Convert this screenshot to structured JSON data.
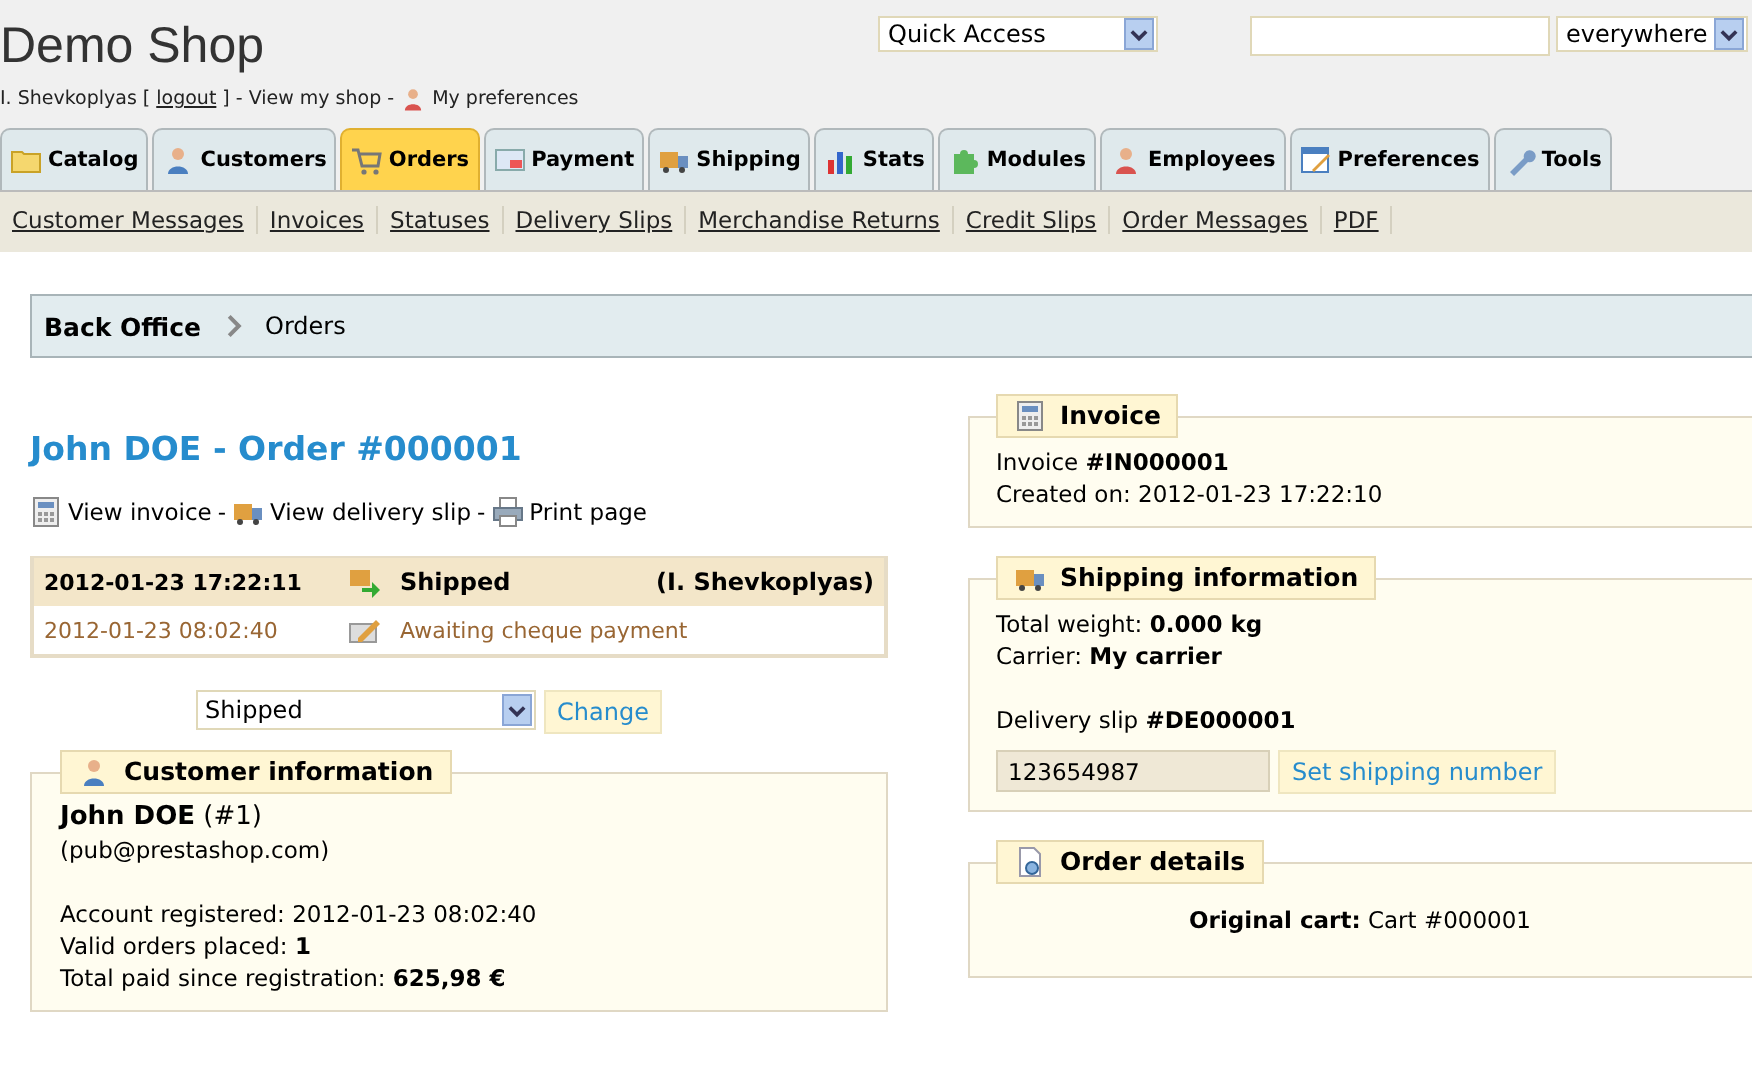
{
  "header": {
    "title": "Demo Shop",
    "quick_access": "Quick Access",
    "search_scope": "everywhere"
  },
  "user_bar": {
    "user": "I. Shevkoplyas [",
    "logout": "logout",
    "middle": "] - View my shop -",
    "preferences": "My preferences"
  },
  "tabs": [
    {
      "label": "Catalog",
      "selected": false
    },
    {
      "label": "Customers",
      "selected": false
    },
    {
      "label": "Orders",
      "selected": true
    },
    {
      "label": "Payment",
      "selected": false
    },
    {
      "label": "Shipping",
      "selected": false
    },
    {
      "label": "Stats",
      "selected": false
    },
    {
      "label": "Modules",
      "selected": false
    },
    {
      "label": "Employees",
      "selected": false
    },
    {
      "label": "Preferences",
      "selected": false
    },
    {
      "label": "Tools",
      "selected": false
    }
  ],
  "subtabs": [
    "Customer Messages",
    "Invoices",
    "Statuses",
    "Delivery Slips",
    "Merchandise Returns",
    "Credit Slips",
    "Order Messages",
    "PDF"
  ],
  "breadcrumb": [
    "Back Office",
    "Orders"
  ],
  "order_title": "John DOE - Order #000001",
  "order_links": [
    {
      "label": "View invoice",
      "separator": "-"
    },
    {
      "label": "View delivery slip",
      "separator": "-"
    },
    {
      "label": "Print page"
    }
  ],
  "history": [
    {
      "date": "2012-01-23 17:22:11",
      "status": "Shipped",
      "employee": "(I. Shevkoplyas)",
      "current": true
    },
    {
      "date": "2012-01-23 08:02:40",
      "status": "Awaiting cheque payment",
      "current": false
    }
  ],
  "status_select": {
    "value": "Shipped",
    "button": "Change"
  },
  "customer_panel": {
    "title": "Customer information",
    "name_line": "**John DOE** (#1)",
    "email": "(pub@prestashop.com)",
    "lines": [
      "Account registered: 2012-01-23 08:02:40",
      "Valid orders placed: **1**",
      "Total paid since registration: **625,98 €**"
    ]
  },
  "invoice_panel": {
    "title": "Invoice",
    "lines": [
      "Invoice **#IN000001**",
      "Created on: 2012-01-23 17:22:10"
    ]
  },
  "shipping_panel": {
    "title": "Shipping information",
    "lines": [
      "Total weight: **0.000 kg**",
      "Carrier: **My carrier**"
    ],
    "delivery_slip": "Delivery slip **#DE000001**",
    "tracking_number": "123654987",
    "button": "Set shipping number"
  },
  "order_details_panel": {
    "title": "Order details",
    "line": "**Original cart:** Cart #000001"
  }
}
